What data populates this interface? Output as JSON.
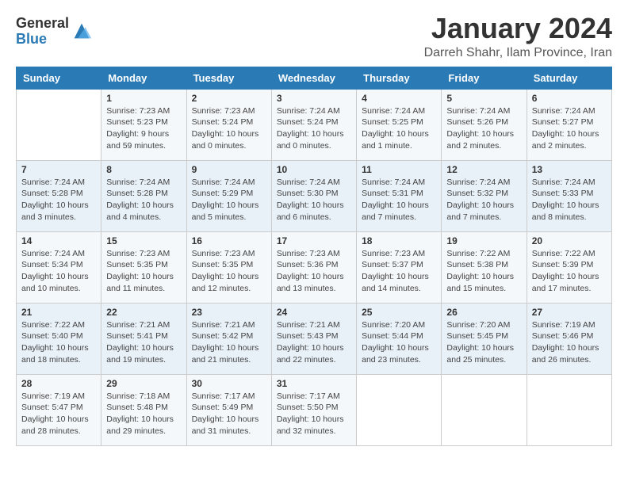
{
  "logo": {
    "general": "General",
    "blue": "Blue"
  },
  "title": {
    "month_year": "January 2024",
    "location": "Darreh Shahr, Ilam Province, Iran"
  },
  "headers": [
    "Sunday",
    "Monday",
    "Tuesday",
    "Wednesday",
    "Thursday",
    "Friday",
    "Saturday"
  ],
  "weeks": [
    [
      {
        "day": "",
        "sunrise": "",
        "sunset": "",
        "daylight": ""
      },
      {
        "day": "1",
        "sunrise": "Sunrise: 7:23 AM",
        "sunset": "Sunset: 5:23 PM",
        "daylight": "Daylight: 9 hours and 59 minutes."
      },
      {
        "day": "2",
        "sunrise": "Sunrise: 7:23 AM",
        "sunset": "Sunset: 5:24 PM",
        "daylight": "Daylight: 10 hours and 0 minutes."
      },
      {
        "day": "3",
        "sunrise": "Sunrise: 7:24 AM",
        "sunset": "Sunset: 5:24 PM",
        "daylight": "Daylight: 10 hours and 0 minutes."
      },
      {
        "day": "4",
        "sunrise": "Sunrise: 7:24 AM",
        "sunset": "Sunset: 5:25 PM",
        "daylight": "Daylight: 10 hours and 1 minute."
      },
      {
        "day": "5",
        "sunrise": "Sunrise: 7:24 AM",
        "sunset": "Sunset: 5:26 PM",
        "daylight": "Daylight: 10 hours and 2 minutes."
      },
      {
        "day": "6",
        "sunrise": "Sunrise: 7:24 AM",
        "sunset": "Sunset: 5:27 PM",
        "daylight": "Daylight: 10 hours and 2 minutes."
      }
    ],
    [
      {
        "day": "7",
        "sunrise": "Sunrise: 7:24 AM",
        "sunset": "Sunset: 5:28 PM",
        "daylight": "Daylight: 10 hours and 3 minutes."
      },
      {
        "day": "8",
        "sunrise": "Sunrise: 7:24 AM",
        "sunset": "Sunset: 5:28 PM",
        "daylight": "Daylight: 10 hours and 4 minutes."
      },
      {
        "day": "9",
        "sunrise": "Sunrise: 7:24 AM",
        "sunset": "Sunset: 5:29 PM",
        "daylight": "Daylight: 10 hours and 5 minutes."
      },
      {
        "day": "10",
        "sunrise": "Sunrise: 7:24 AM",
        "sunset": "Sunset: 5:30 PM",
        "daylight": "Daylight: 10 hours and 6 minutes."
      },
      {
        "day": "11",
        "sunrise": "Sunrise: 7:24 AM",
        "sunset": "Sunset: 5:31 PM",
        "daylight": "Daylight: 10 hours and 7 minutes."
      },
      {
        "day": "12",
        "sunrise": "Sunrise: 7:24 AM",
        "sunset": "Sunset: 5:32 PM",
        "daylight": "Daylight: 10 hours and 7 minutes."
      },
      {
        "day": "13",
        "sunrise": "Sunrise: 7:24 AM",
        "sunset": "Sunset: 5:33 PM",
        "daylight": "Daylight: 10 hours and 8 minutes."
      }
    ],
    [
      {
        "day": "14",
        "sunrise": "Sunrise: 7:24 AM",
        "sunset": "Sunset: 5:34 PM",
        "daylight": "Daylight: 10 hours and 10 minutes."
      },
      {
        "day": "15",
        "sunrise": "Sunrise: 7:23 AM",
        "sunset": "Sunset: 5:35 PM",
        "daylight": "Daylight: 10 hours and 11 minutes."
      },
      {
        "day": "16",
        "sunrise": "Sunrise: 7:23 AM",
        "sunset": "Sunset: 5:35 PM",
        "daylight": "Daylight: 10 hours and 12 minutes."
      },
      {
        "day": "17",
        "sunrise": "Sunrise: 7:23 AM",
        "sunset": "Sunset: 5:36 PM",
        "daylight": "Daylight: 10 hours and 13 minutes."
      },
      {
        "day": "18",
        "sunrise": "Sunrise: 7:23 AM",
        "sunset": "Sunset: 5:37 PM",
        "daylight": "Daylight: 10 hours and 14 minutes."
      },
      {
        "day": "19",
        "sunrise": "Sunrise: 7:22 AM",
        "sunset": "Sunset: 5:38 PM",
        "daylight": "Daylight: 10 hours and 15 minutes."
      },
      {
        "day": "20",
        "sunrise": "Sunrise: 7:22 AM",
        "sunset": "Sunset: 5:39 PM",
        "daylight": "Daylight: 10 hours and 17 minutes."
      }
    ],
    [
      {
        "day": "21",
        "sunrise": "Sunrise: 7:22 AM",
        "sunset": "Sunset: 5:40 PM",
        "daylight": "Daylight: 10 hours and 18 minutes."
      },
      {
        "day": "22",
        "sunrise": "Sunrise: 7:21 AM",
        "sunset": "Sunset: 5:41 PM",
        "daylight": "Daylight: 10 hours and 19 minutes."
      },
      {
        "day": "23",
        "sunrise": "Sunrise: 7:21 AM",
        "sunset": "Sunset: 5:42 PM",
        "daylight": "Daylight: 10 hours and 21 minutes."
      },
      {
        "day": "24",
        "sunrise": "Sunrise: 7:21 AM",
        "sunset": "Sunset: 5:43 PM",
        "daylight": "Daylight: 10 hours and 22 minutes."
      },
      {
        "day": "25",
        "sunrise": "Sunrise: 7:20 AM",
        "sunset": "Sunset: 5:44 PM",
        "daylight": "Daylight: 10 hours and 23 minutes."
      },
      {
        "day": "26",
        "sunrise": "Sunrise: 7:20 AM",
        "sunset": "Sunset: 5:45 PM",
        "daylight": "Daylight: 10 hours and 25 minutes."
      },
      {
        "day": "27",
        "sunrise": "Sunrise: 7:19 AM",
        "sunset": "Sunset: 5:46 PM",
        "daylight": "Daylight: 10 hours and 26 minutes."
      }
    ],
    [
      {
        "day": "28",
        "sunrise": "Sunrise: 7:19 AM",
        "sunset": "Sunset: 5:47 PM",
        "daylight": "Daylight: 10 hours and 28 minutes."
      },
      {
        "day": "29",
        "sunrise": "Sunrise: 7:18 AM",
        "sunset": "Sunset: 5:48 PM",
        "daylight": "Daylight: 10 hours and 29 minutes."
      },
      {
        "day": "30",
        "sunrise": "Sunrise: 7:17 AM",
        "sunset": "Sunset: 5:49 PM",
        "daylight": "Daylight: 10 hours and 31 minutes."
      },
      {
        "day": "31",
        "sunrise": "Sunrise: 7:17 AM",
        "sunset": "Sunset: 5:50 PM",
        "daylight": "Daylight: 10 hours and 32 minutes."
      },
      {
        "day": "",
        "sunrise": "",
        "sunset": "",
        "daylight": ""
      },
      {
        "day": "",
        "sunrise": "",
        "sunset": "",
        "daylight": ""
      },
      {
        "day": "",
        "sunrise": "",
        "sunset": "",
        "daylight": ""
      }
    ]
  ]
}
